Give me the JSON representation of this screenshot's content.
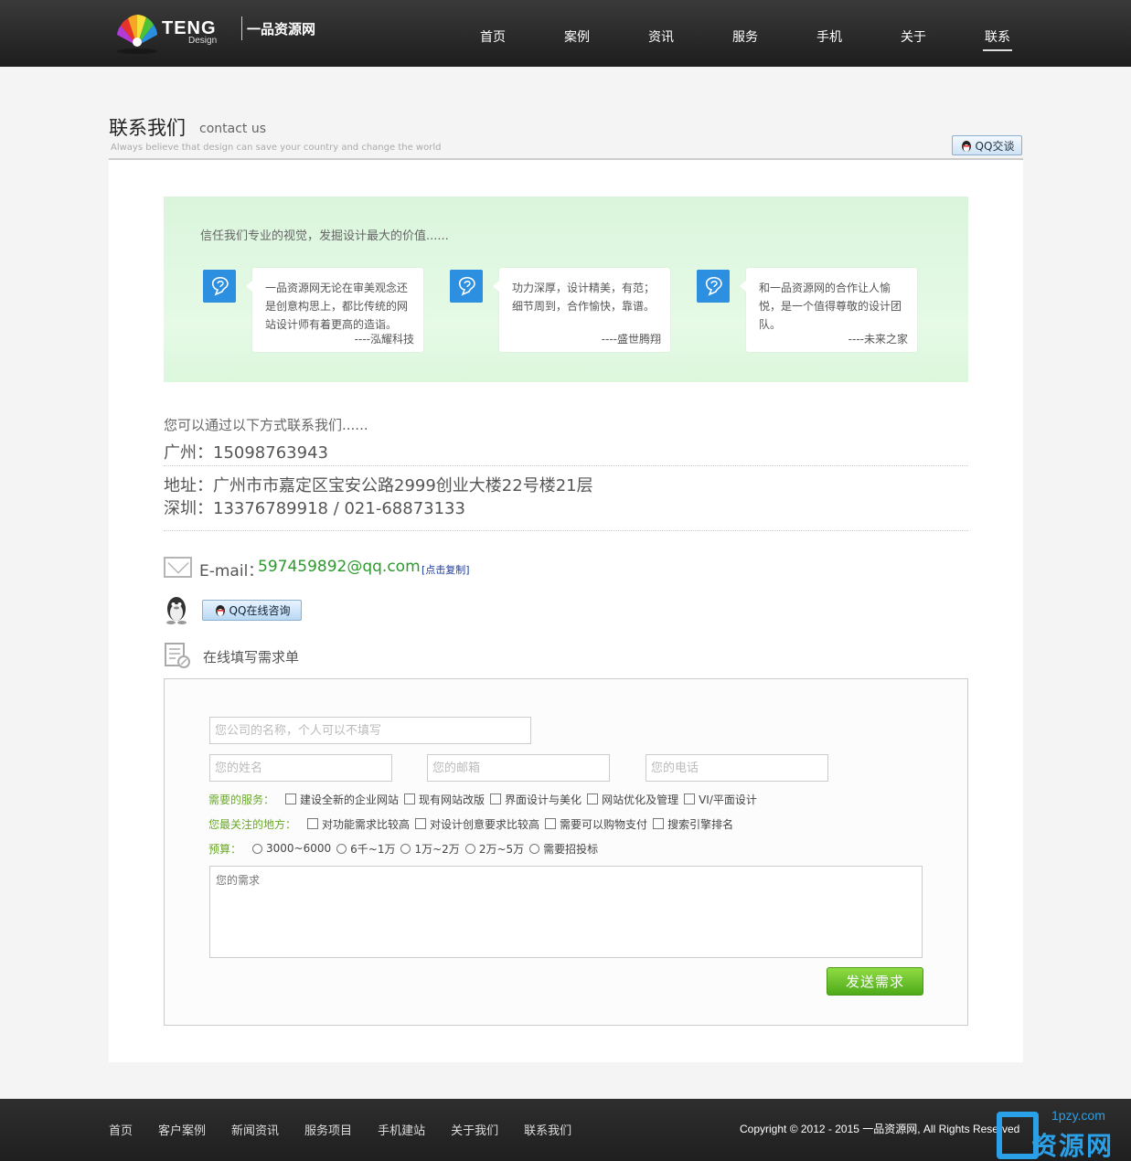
{
  "header": {
    "logo_text": "TENG",
    "logo_sub": "Design",
    "logo_cn": "一品资源网",
    "nav": [
      "首页",
      "案例",
      "资讯",
      "服务",
      "手机",
      "关于",
      "联系"
    ],
    "active_index": 6
  },
  "page": {
    "title_cn": "联系我们",
    "title_en": "contact us",
    "subtitle": "Always believe that design can save your country and change the world",
    "qq_talk": "QQ交谈"
  },
  "testimonials": {
    "intro": "信任我们专业的视觉，发掘设计最大的价值......",
    "items": [
      {
        "text": "一品资源网无论在审美观念还是创意构思上，都比传统的网站设计师有着更高的造诣。",
        "by": "----泓耀科技"
      },
      {
        "text": "功力深厚，设计精美，有范；细节周到，合作愉快，靠谱。",
        "by": "----盛世腾翔"
      },
      {
        "text": "和一品资源网的合作让人愉悦，是一个值得尊敬的设计团队。",
        "by": "----未来之家"
      }
    ]
  },
  "contact": {
    "intro": "您可以通过以下方式联系我们......",
    "guangzhou": "广州：15098763943",
    "address": "地址：广州市市嘉定区宝安公路2999创业大楼22号楼21层",
    "shenzhen": "深圳：13376789918 / 021-68873133",
    "email_label": "E-mail：",
    "email": "597459892@qq.com",
    "copy": "[点击复制]",
    "qq_online": "QQ在线咨询",
    "form_heading": "在线填写需求单"
  },
  "form": {
    "company_placeholder": "您公司的名称，个人可以不填写",
    "name_placeholder": "您的姓名",
    "email_placeholder": "您的邮箱",
    "phone_placeholder": "您的电话",
    "services_label": "需要的服务：",
    "services": [
      "建设全新的企业网站",
      "现有网站改版",
      "界面设计与美化",
      "网站优化及管理",
      "VI/平面设计"
    ],
    "focus_label": "您最关注的地方：",
    "focus": [
      "对功能需求比较高",
      "对设计创意要求比较高",
      "需要可以购物支付",
      "搜索引擎排名"
    ],
    "budget_label": "预算：",
    "budget": [
      "3000~6000",
      "6千~1万",
      "1万~2万",
      "2万~5万",
      "需要招投标"
    ],
    "needs_placeholder": "您的需求",
    "submit": "发送需求"
  },
  "footer": {
    "nav": [
      "首页",
      "客户案例",
      "新闻资讯",
      "服务项目",
      "手机建站",
      "关于我们",
      "联系我们"
    ],
    "copyright": "Copyright © 2012 - 2015 一品资源网, All Rights Reserved",
    "watermark_url": "1pzy.com",
    "watermark_cn": "资源网"
  },
  "colors": {
    "accent_green": "#2c9a2c",
    "label_green": "#6aa82a",
    "icon_blue": "#2c8fe0"
  }
}
